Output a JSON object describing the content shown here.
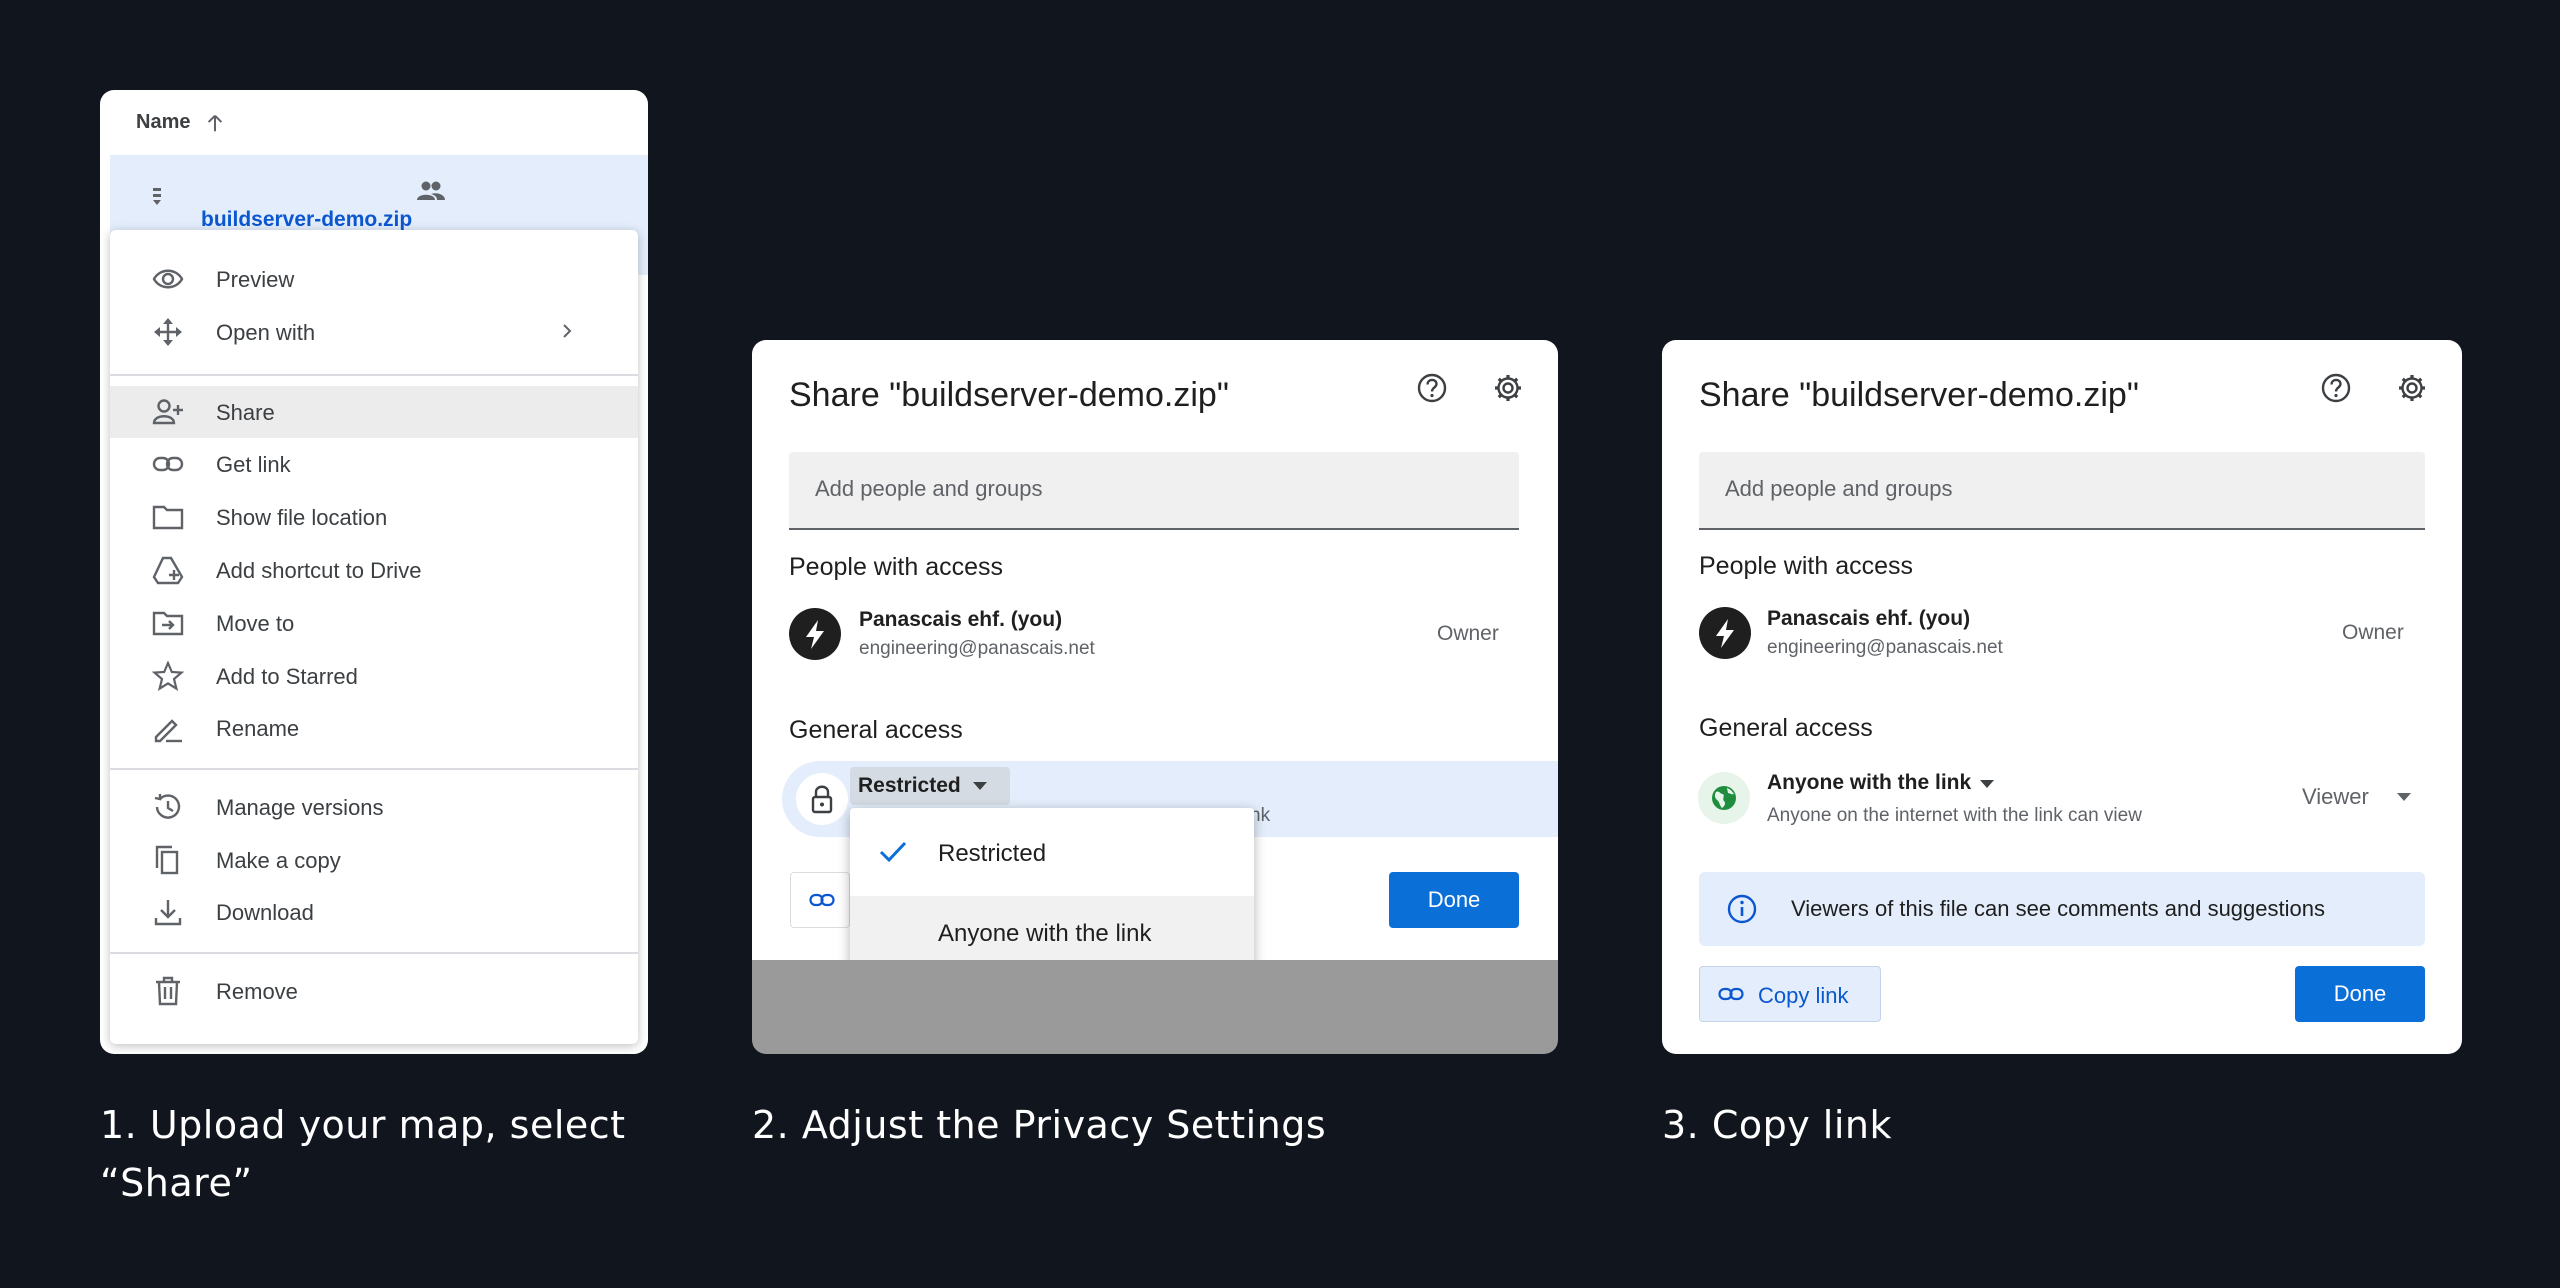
{
  "panel1": {
    "column_header": "Name",
    "file_name": "buildserver-demo.zip",
    "menu_items": [
      {
        "label": "Preview",
        "icon": "eye-icon"
      },
      {
        "label": "Open with",
        "icon": "move-icon"
      },
      {
        "label": "Share",
        "icon": "person-add-icon"
      },
      {
        "label": "Get link",
        "icon": "link-icon"
      },
      {
        "label": "Show file location",
        "icon": "folder-icon"
      },
      {
        "label": "Add shortcut to Drive",
        "icon": "drive-shortcut-icon"
      },
      {
        "label": "Move to",
        "icon": "move-folder-icon"
      },
      {
        "label": "Add to Starred",
        "icon": "star-icon"
      },
      {
        "label": "Rename",
        "icon": "pencil-icon"
      },
      {
        "label": "Manage versions",
        "icon": "history-icon"
      },
      {
        "label": "Make a copy",
        "icon": "copy-icon"
      },
      {
        "label": "Download",
        "icon": "download-icon"
      },
      {
        "label": "Remove",
        "icon": "trash-icon"
      }
    ]
  },
  "share_dialog": {
    "title": "Share \"buildserver-demo.zip\"",
    "add_placeholder": "Add people and groups",
    "people_heading": "People with access",
    "person_name": "Panascais ehf. (you)",
    "person_email": "engineering@panascais.net",
    "person_role": "Owner",
    "general_heading": "General access",
    "done_label": "Done"
  },
  "panel2": {
    "access_value": "Restricted",
    "hidden_desc_tail": "nk",
    "options": [
      "Restricted",
      "Anyone with the link"
    ]
  },
  "panel3": {
    "access_value": "Anyone with the link",
    "access_desc": "Anyone on the internet with the link can view",
    "role": "Viewer",
    "info_text": "Viewers of this file can see comments and suggestions",
    "copy_link_label": "Copy link"
  },
  "captions": {
    "step1_line1": "1. Upload your map, select",
    "step1_line2": "“Share”",
    "step2": "2. Adjust the Privacy Settings",
    "step3": "3. Copy link"
  },
  "colors": {
    "background": "#11151e",
    "accent_blue": "#0b6fd8",
    "selection_blue": "#e3edfb"
  }
}
